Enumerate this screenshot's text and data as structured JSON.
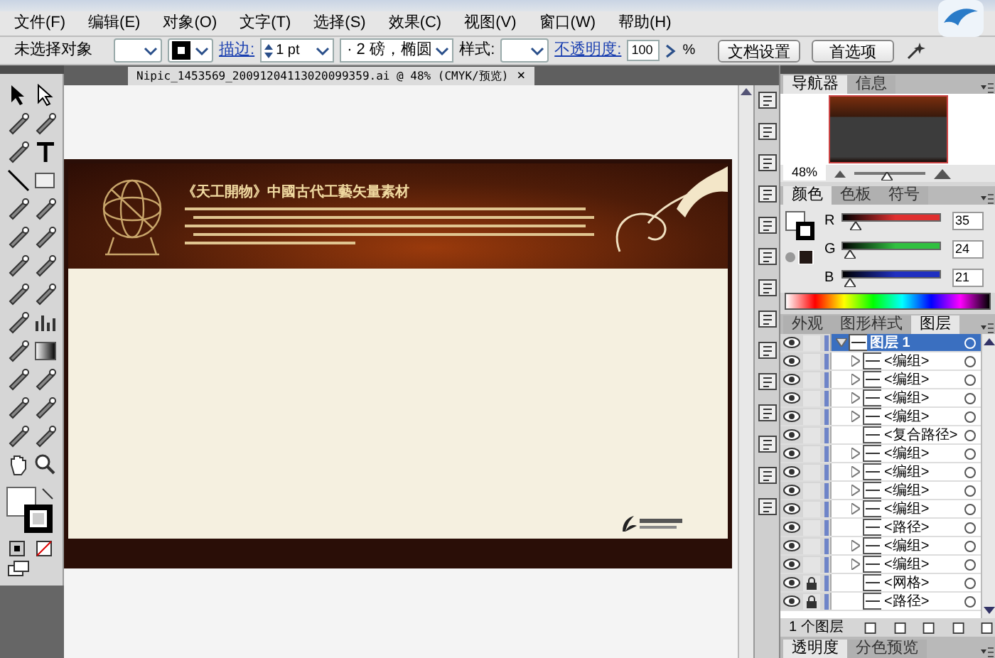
{
  "menu": [
    "文件(F)",
    "编辑(E)",
    "对象(O)",
    "文字(T)",
    "选择(S)",
    "效果(C)",
    "视图(V)",
    "窗口(W)",
    "帮助(H)"
  ],
  "control_bar": {
    "selection": "未选择对象",
    "stroke_label": "描边:",
    "stroke_weight": "1 pt",
    "brush": "· 2 磅，椭圆",
    "style_label": "样式:",
    "opacity_label": "不透明度:",
    "opacity": "100",
    "opacity_unit": "%",
    "buttons": [
      "文档设置",
      "首选项"
    ]
  },
  "document_tab": {
    "title": "Nipic_1453569_20091204113020099359.ai @ 48% (CMYK/预览)",
    "close": "×"
  },
  "artwork": {
    "title": "《天工開物》中國古代工藝矢量素材"
  },
  "navigator": {
    "tabs": [
      {
        "label": "导航器",
        "selected": true
      },
      {
        "label": "信息",
        "selected": false
      }
    ],
    "zoom": "48%",
    "zoom_slider": {
      "level": 0.45
    }
  },
  "color": {
    "tabs": [
      {
        "label": "颜色",
        "selected": true
      },
      {
        "label": "色板",
        "selected": false
      },
      {
        "label": "符号",
        "selected": false
      }
    ],
    "channels": [
      {
        "name": "R",
        "value": "35",
        "level": 0.14,
        "color": "#e03030"
      },
      {
        "name": "G",
        "value": "24",
        "level": 0.09,
        "color": "#30c040"
      },
      {
        "name": "B",
        "value": "21",
        "level": 0.08,
        "color": "#2030c0"
      }
    ]
  },
  "layers": {
    "tabs": [
      {
        "label": "外观",
        "selected": false
      },
      {
        "label": "图形样式",
        "selected": false
      },
      {
        "label": "图层",
        "selected": true
      }
    ],
    "items": [
      {
        "name": "图层 1",
        "selected": true,
        "expanded": true,
        "locked": false,
        "children": [
          {
            "name": "<编组>",
            "has_children": true,
            "locked": false
          },
          {
            "name": "<编组>",
            "has_children": true,
            "locked": false
          },
          {
            "name": "<编组>",
            "has_children": true,
            "locked": false
          },
          {
            "name": "<编组>",
            "has_children": true,
            "locked": false
          },
          {
            "name": "<复合路径>",
            "has_children": false,
            "locked": false
          },
          {
            "name": "<编组>",
            "has_children": true,
            "locked": false
          },
          {
            "name": "<编组>",
            "has_children": true,
            "locked": false
          },
          {
            "name": "<编组>",
            "has_children": true,
            "locked": false
          },
          {
            "name": "<编组>",
            "has_children": true,
            "locked": false
          },
          {
            "name": "<路径>",
            "has_children": false,
            "locked": false
          },
          {
            "name": "<编组>",
            "has_children": true,
            "locked": false
          },
          {
            "name": "<编组>",
            "has_children": true,
            "locked": false
          },
          {
            "name": "<网格>",
            "has_children": false,
            "locked": true
          },
          {
            "name": "<路径>",
            "has_children": false,
            "locked": true
          }
        ]
      }
    ],
    "footer": "1 个图层"
  },
  "bottom_panel": {
    "tabs": [
      {
        "label": "透明度",
        "selected": true
      },
      {
        "label": "分色预览",
        "selected": false
      }
    ]
  }
}
